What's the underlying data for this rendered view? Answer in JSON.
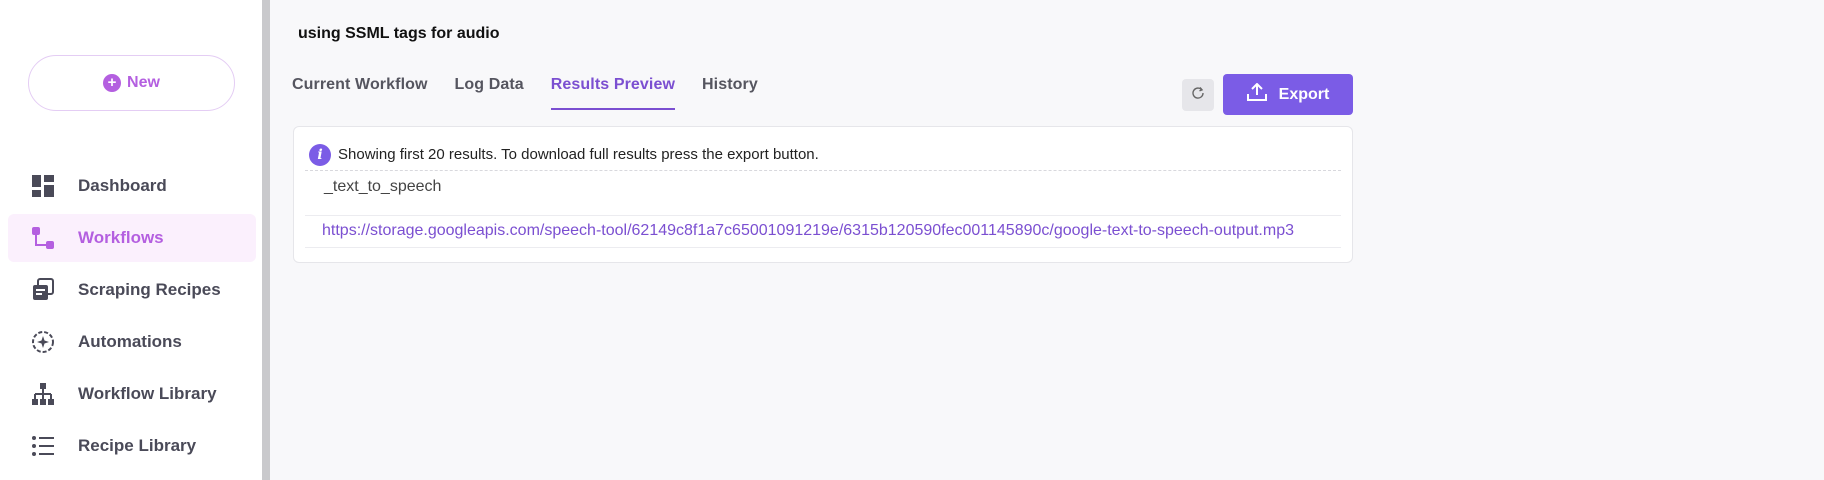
{
  "sidebar": {
    "new_label": "New",
    "items": [
      {
        "label": "Dashboard",
        "icon": "dashboard-icon",
        "active": false
      },
      {
        "label": "Workflows",
        "icon": "workflow-icon",
        "active": true
      },
      {
        "label": "Scraping Recipes",
        "icon": "scraping-recipes-icon",
        "active": false
      },
      {
        "label": "Automations",
        "icon": "automations-icon",
        "active": false
      },
      {
        "label": "Workflow Library",
        "icon": "workflow-library-icon",
        "active": false
      },
      {
        "label": "Recipe Library",
        "icon": "recipe-library-icon",
        "active": false
      }
    ]
  },
  "main": {
    "title": "using SSML tags for audio",
    "tabs": [
      {
        "label": "Current Workflow",
        "active": false
      },
      {
        "label": "Log Data",
        "active": false
      },
      {
        "label": "Results Preview",
        "active": true
      },
      {
        "label": "History",
        "active": false
      }
    ],
    "export_label": "Export",
    "results": {
      "info": "Showing first 20 results. To download full results press the export button.",
      "column_header": "_text_to_speech",
      "rows": [
        "https://storage.googleapis.com/speech-tool/62149c8f1a7c65001091219e/6315b120590fec001145890c/google-text-to-speech-output.mp3"
      ]
    }
  },
  "colors": {
    "accent": "#7b5ce6",
    "active_nav": "#b45fe0",
    "active_nav_bg": "#fbf0fd"
  }
}
